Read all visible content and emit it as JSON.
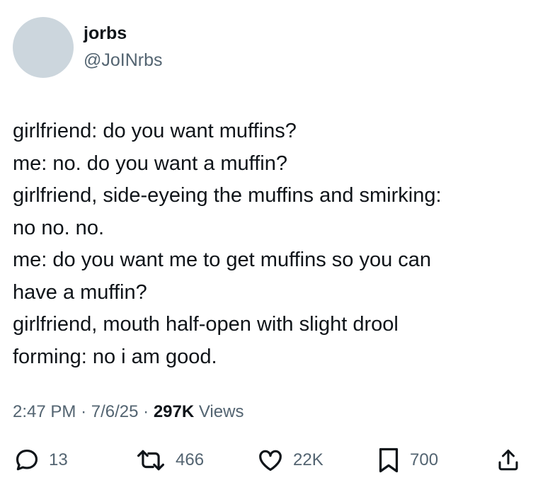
{
  "author": {
    "display_name": "jorbs",
    "handle": "@JoINrbs"
  },
  "tweet": {
    "lines": [
      "girlfriend: do you want muffins?",
      "me: no. do you want a muffin?",
      "girlfriend, side-eyeing the muffins and smirking:",
      "no no. no.",
      "me: do you want me to get muffins so you can",
      "have a muffin?",
      "girlfriend, mouth half-open with slight drool",
      "forming: no i am good."
    ],
    "time": "2:47 PM",
    "date": "7/6/25",
    "separator": "·",
    "views_count": "297K",
    "views_label": "Views"
  },
  "actions": {
    "replies": "13",
    "reposts": "466",
    "likes": "22K",
    "bookmarks": "700"
  },
  "icons": {
    "reply": "reply-bubble-icon",
    "repost": "repost-arrows-icon",
    "like": "heart-icon",
    "bookmark": "bookmark-icon",
    "share": "share-upload-icon"
  },
  "colors": {
    "text": "#0f1419",
    "secondary": "#536471",
    "avatar_placeholder": "#ccd6dd"
  }
}
